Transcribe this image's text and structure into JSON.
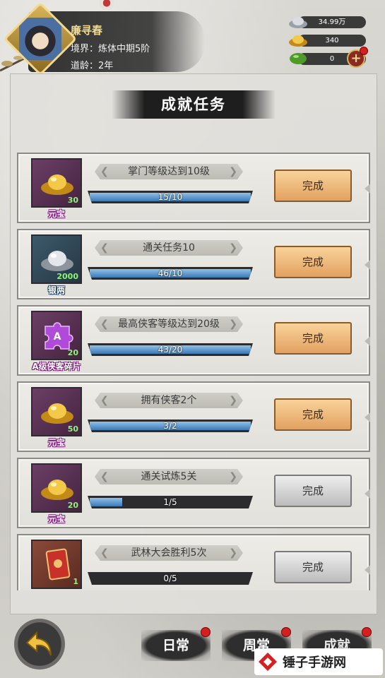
{
  "player": {
    "name": "廉寻春",
    "realm": "境界：炼体中期5阶",
    "age": "道龄：2年"
  },
  "resources": {
    "silver": "34.99万",
    "gold": "340",
    "jade": "0",
    "plus": "+"
  },
  "panel": {
    "title": "成就任务"
  },
  "tasks": [
    {
      "reward_name": "元宝",
      "reward_count": "30",
      "name": "掌门等级达到10级",
      "progress": "15/10",
      "fill": 1.0,
      "button": "完成",
      "state": "done"
    },
    {
      "reward_name": "银两",
      "reward_count": "2000",
      "name": "通关任务10",
      "progress": "46/10",
      "fill": 1.0,
      "button": "完成",
      "state": "done"
    },
    {
      "reward_name": "A级侠客碎片",
      "reward_count": "20",
      "name": "最高侠客等级达到20级",
      "progress": "43/20",
      "fill": 1.0,
      "button": "完成",
      "state": "done"
    },
    {
      "reward_name": "元宝",
      "reward_count": "50",
      "name": "拥有侠客2个",
      "progress": "3/2",
      "fill": 1.0,
      "button": "完成",
      "state": "done"
    },
    {
      "reward_name": "元宝",
      "reward_count": "20",
      "name": "通关试炼5关",
      "progress": "1/5",
      "fill": 0.2,
      "button": "完成",
      "state": "locked"
    },
    {
      "reward_name": "",
      "reward_count": "1",
      "name": "武林大会胜利5次",
      "progress": "0/5",
      "fill": 0.0,
      "button": "完成",
      "state": "locked"
    }
  ],
  "nav": {
    "daily": "日常",
    "weekly": "周常",
    "achievement": "成就"
  },
  "watermark": {
    "text": "锤子手游网"
  },
  "colors": {
    "progress_fill": "#3c78b4",
    "done_button": "#e2a160",
    "reward_count": "#8ff27a",
    "badge_red": "#d42020"
  }
}
